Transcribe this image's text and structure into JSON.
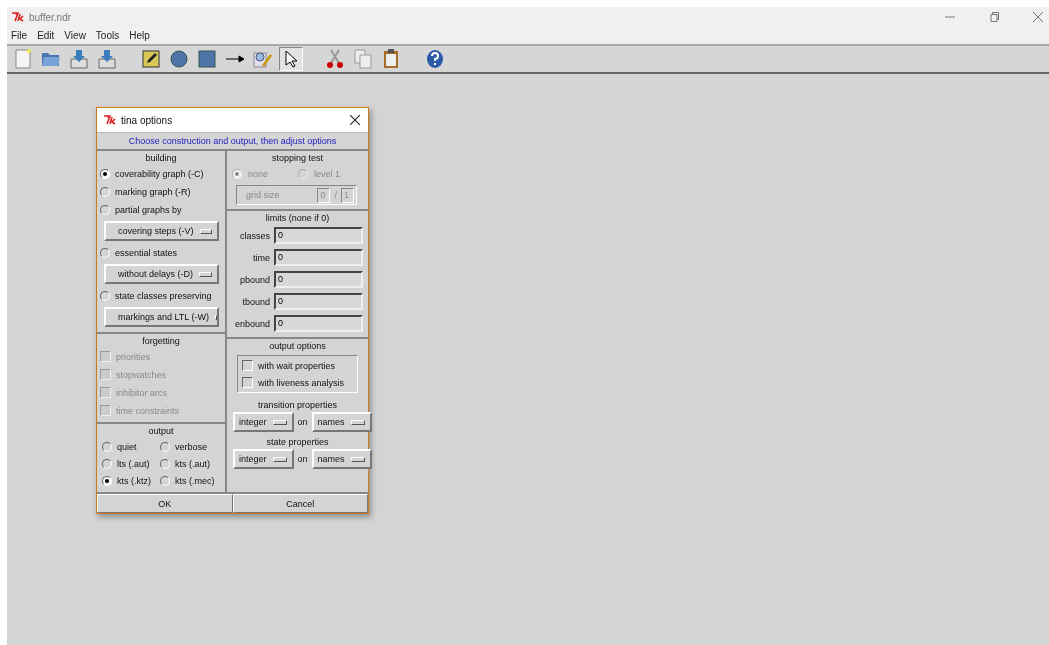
{
  "window": {
    "title": "buffer.ndr"
  },
  "menu": [
    "File",
    "Edit",
    "View",
    "Tools",
    "Help"
  ],
  "toolbar": [
    {
      "kind": "new",
      "selected": false
    },
    {
      "kind": "open",
      "selected": false
    },
    {
      "kind": "import",
      "selected": false
    },
    {
      "kind": "export",
      "selected": false
    },
    {
      "kind": "sep"
    },
    {
      "kind": "note",
      "selected": false
    },
    {
      "kind": "place",
      "selected": false
    },
    {
      "kind": "transition",
      "selected": false
    },
    {
      "kind": "arc",
      "selected": false
    },
    {
      "kind": "edit",
      "selected": false
    },
    {
      "kind": "pointer",
      "selected": true
    },
    {
      "kind": "sep"
    },
    {
      "kind": "cut",
      "selected": false
    },
    {
      "kind": "copy",
      "selected": false
    },
    {
      "kind": "paste",
      "selected": false
    },
    {
      "kind": "sep"
    },
    {
      "kind": "help",
      "selected": false
    }
  ],
  "dialog": {
    "title": "tina options",
    "header": "Choose construction and output, then adjust options",
    "building": {
      "title": "building",
      "items": [
        {
          "kind": "radio",
          "label": "coverability graph (-C)",
          "selected": true
        },
        {
          "kind": "radio",
          "label": "marking graph (-R)",
          "selected": false
        },
        {
          "kind": "radio",
          "label": "partial graphs by",
          "selected": false
        },
        {
          "kind": "dropdown",
          "label": "covering steps (-V)"
        },
        {
          "kind": "radio",
          "label": "essential states",
          "selected": false
        },
        {
          "kind": "dropdown",
          "label": "without delays (-D)"
        },
        {
          "kind": "radio",
          "label": "state classes preserving",
          "selected": false
        },
        {
          "kind": "dropdown",
          "label": "markings and LTL (-W)"
        }
      ]
    },
    "forgetting": {
      "title": "forgetting",
      "items": [
        {
          "label": "priorities",
          "checked": false,
          "disabled": true
        },
        {
          "label": "stopwatches",
          "checked": false,
          "disabled": true
        },
        {
          "label": "inhibitor arcs",
          "checked": false,
          "disabled": true
        },
        {
          "label": "time constraints",
          "checked": false,
          "disabled": true
        }
      ]
    },
    "output": {
      "title": "output",
      "items": [
        {
          "label": "quiet",
          "selected": false
        },
        {
          "label": "verbose",
          "selected": false
        },
        {
          "label": "lts (.aut)",
          "selected": false
        },
        {
          "label": "kts (.aut)",
          "selected": false
        },
        {
          "label": "kts (.ktz)",
          "selected": true
        },
        {
          "label": "kts (.mec)",
          "selected": false
        }
      ]
    },
    "stopping_test": {
      "title": "stopping test",
      "options": [
        {
          "label": "none",
          "selected": true,
          "disabled": true
        },
        {
          "label": "level 1",
          "selected": false,
          "disabled": true
        }
      ],
      "grid_size": {
        "label": "grid size",
        "value_1": "0",
        "separator": "/",
        "value_2": "1",
        "disabled": true
      }
    },
    "limits": {
      "title": "limits (none if 0)",
      "fields": [
        {
          "label": "classes",
          "value": "0"
        },
        {
          "label": "time",
          "value": "0"
        },
        {
          "label": "pbound",
          "value": "0"
        },
        {
          "label": "tbound",
          "value": "0"
        },
        {
          "label": "enbound",
          "value": "0"
        }
      ]
    },
    "output_options": {
      "title": "output options",
      "checkboxes": [
        {
          "label": "with wait properties",
          "checked": false
        },
        {
          "label": "with liveness analysis",
          "checked": false
        }
      ],
      "properties": [
        {
          "title": "transition properties",
          "type": "integer",
          "on": "on",
          "target": "names"
        },
        {
          "title": "state properties",
          "type": "integer",
          "on": "on",
          "target": "names"
        }
      ]
    },
    "buttons": [
      "OK",
      "Cancel"
    ]
  }
}
